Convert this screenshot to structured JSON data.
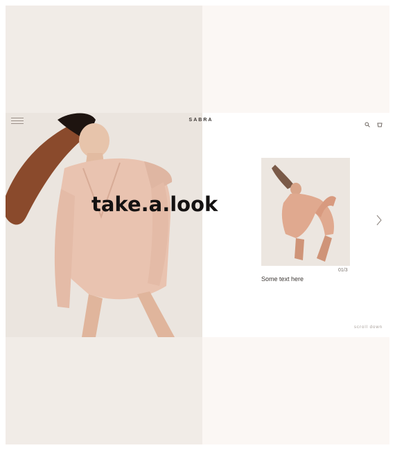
{
  "brand": {
    "name": "SABRA"
  },
  "hero": {
    "headline": "take.a.look",
    "image_description": "model in blush oversized blazer"
  },
  "card": {
    "title": "Some text here",
    "index": "01/3",
    "image_description": "dancer in blush outfit"
  },
  "footer": {
    "link_label": "scroll down"
  },
  "colors": {
    "accent": "#e8c7b8",
    "panel_bg": "#ffffff",
    "hero_bg": "#ebe5df",
    "text_dark": "#141212"
  },
  "icons": [
    "menu-icon",
    "search-icon",
    "cart-icon",
    "chevron-right-icon"
  ]
}
